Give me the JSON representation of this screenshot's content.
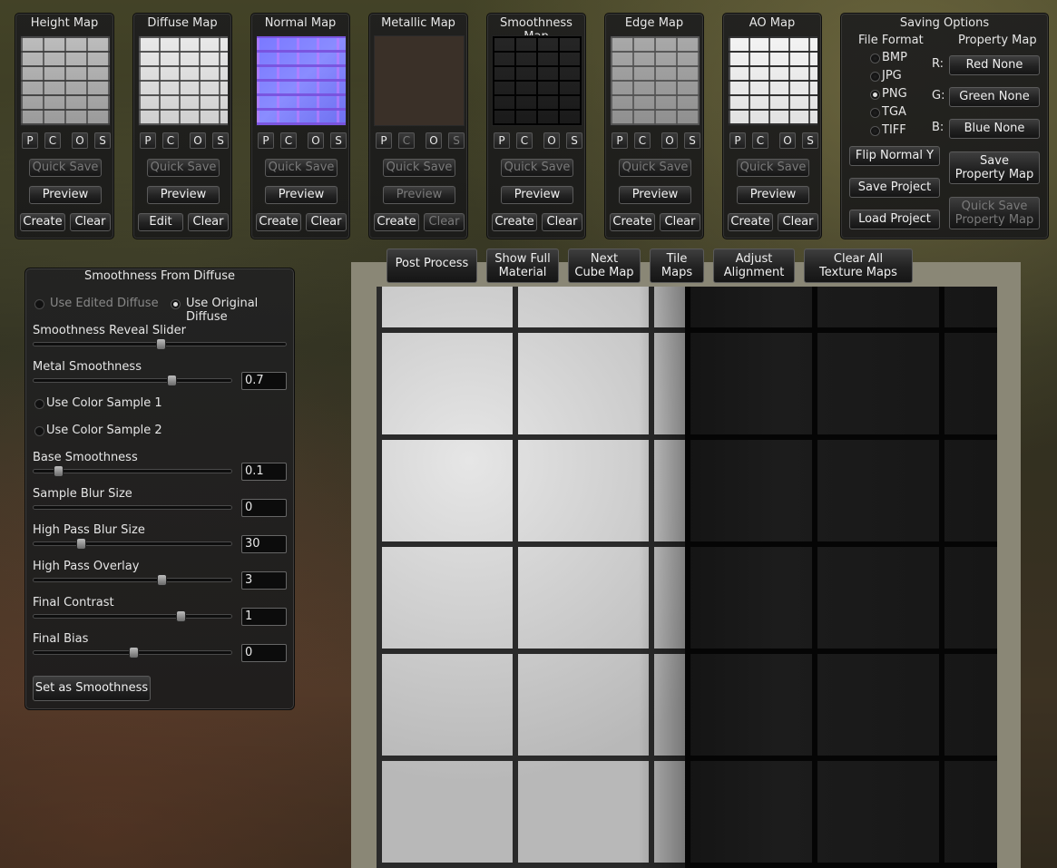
{
  "maps": [
    {
      "title": "Height Map",
      "buttons": [
        "P",
        "C",
        "O",
        "S"
      ],
      "quick_save": "Quick Save",
      "preview": "Preview",
      "create": "Create",
      "clear": "Clear"
    },
    {
      "title": "Diffuse Map",
      "buttons": [
        "P",
        "C",
        "O",
        "S"
      ],
      "quick_save": "Quick Save",
      "preview": "Preview",
      "create": "Edit",
      "clear": "Clear"
    },
    {
      "title": "Normal Map",
      "buttons": [
        "P",
        "C",
        "O",
        "S"
      ],
      "quick_save": "Quick Save",
      "preview": "Preview",
      "create": "Create",
      "clear": "Clear"
    },
    {
      "title": "Metallic Map",
      "buttons": [
        "P",
        "C",
        "O",
        "S"
      ],
      "quick_save": "Quick Save",
      "preview": "Preview",
      "create": "Create",
      "clear": "Clear"
    },
    {
      "title": "Smoothness Map",
      "buttons": [
        "P",
        "C",
        "O",
        "S"
      ],
      "quick_save": "Quick Save",
      "preview": "Preview",
      "create": "Create",
      "clear": "Clear"
    },
    {
      "title": "Edge Map",
      "buttons": [
        "P",
        "C",
        "O",
        "S"
      ],
      "quick_save": "Quick Save",
      "preview": "Preview",
      "create": "Create",
      "clear": "Clear"
    },
    {
      "title": "AO Map",
      "buttons": [
        "P",
        "C",
        "O",
        "S"
      ],
      "quick_save": "Quick Save",
      "preview": "Preview",
      "create": "Create",
      "clear": "Clear"
    }
  ],
  "saving": {
    "title": "Saving Options",
    "file_format_label": "File Format",
    "property_map_label": "Property Map",
    "formats": [
      "BMP",
      "JPG",
      "PNG",
      "TGA",
      "TIFF"
    ],
    "selected_format": "PNG",
    "channels": [
      {
        "label": "R:",
        "value": "Red None"
      },
      {
        "label": "G:",
        "value": "Green None"
      },
      {
        "label": "B:",
        "value": "Blue None"
      }
    ],
    "flip_normal": "Flip Normal Y",
    "save_project": "Save Project",
    "load_project": "Load Project",
    "save_property_map_line1": "Save",
    "save_property_map_line2": "Property Map",
    "quick_save_property_map_line1": "Quick Save",
    "quick_save_property_map_line2": "Property Map"
  },
  "toolbar": {
    "post_process": "Post Process",
    "show_full_material_1": "Show Full",
    "show_full_material_2": "Material",
    "next_cube_map_1": "Next",
    "next_cube_map_2": "Cube Map",
    "tile_maps_1": "Tile",
    "tile_maps_2": "Maps",
    "adjust_alignment_1": "Adjust",
    "adjust_alignment_2": "Alignment",
    "clear_all_1": "Clear All",
    "clear_all_2": "Texture Maps"
  },
  "smoothness": {
    "title": "Smoothness From Diffuse",
    "use_edited_diffuse": "Use Edited Diffuse",
    "use_original_diffuse": "Use Original Diffuse",
    "reveal_slider_label": "Smoothness Reveal Slider",
    "reveal_value": 0.5,
    "metal_smoothness_label": "Metal Smoothness",
    "metal_smoothness_value": "0.7",
    "use_color_sample_1": "Use Color Sample 1",
    "use_color_sample_2": "Use Color Sample 2",
    "base_smoothness_label": "Base Smoothness",
    "base_smoothness_value": "0.1",
    "sample_blur_label": "Sample Blur Size",
    "sample_blur_value": "0",
    "high_pass_blur_label": "High Pass Blur Size",
    "high_pass_blur_value": "30",
    "high_pass_overlay_label": "High Pass Overlay",
    "high_pass_overlay_value": "3",
    "final_contrast_label": "Final Contrast",
    "final_contrast_value": "1",
    "final_bias_label": "Final Bias",
    "final_bias_value": "0",
    "set_button": "Set as Smoothness"
  }
}
